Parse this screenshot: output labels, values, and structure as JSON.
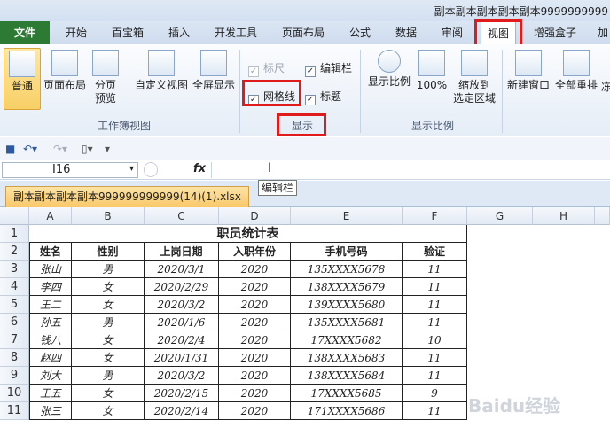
{
  "window": {
    "title": "副本副本副本副本副本9999999999"
  },
  "tabs": [
    "开始",
    "百宝箱",
    "插入",
    "开发工具",
    "页面布局",
    "公式",
    "数据",
    "审阅",
    "视图",
    "增强盒子",
    "加"
  ],
  "file_tab": "文件",
  "ribbon": {
    "workbook_views": {
      "normal": "普通",
      "page_layout": "页面布局",
      "page_break": "分页\n预览",
      "custom_view": "自定义视图",
      "full_screen": "全屏显示",
      "group": "工作簿视图"
    },
    "show": {
      "ruler": "标尺",
      "formula_bar": "编辑栏",
      "gridlines": "网格线",
      "headings": "标题",
      "group": "显示"
    },
    "zoom": {
      "zoom": "显示比例",
      "hundred": "100%",
      "zoom_to_selection": "缩放到\n选定区域",
      "group": "显示比例"
    },
    "window": {
      "new_window": "新建窗口",
      "arrange_all": "全部重排",
      "more": "冻"
    }
  },
  "formula_bar": {
    "name_box": "I16",
    "fx": "fx",
    "value": ""
  },
  "tooltip": "编辑栏",
  "file_tab_name": "副本副本副本副本999999999999(14)(1).xlsx",
  "columns": [
    "A",
    "B",
    "C",
    "D",
    "E",
    "F",
    "G",
    "H"
  ],
  "rows": [
    "1",
    "2",
    "3",
    "4",
    "5",
    "6",
    "7",
    "8",
    "9",
    "10",
    "11"
  ],
  "table": {
    "title": "职员统计表",
    "headers": [
      "姓名",
      "性别",
      "上岗日期",
      "入职年份",
      "手机号码",
      "验证"
    ],
    "data": [
      [
        "张山",
        "男",
        "2020/3/1",
        "2020",
        "135XXXX5678",
        "11"
      ],
      [
        "李四",
        "女",
        "2020/2/29",
        "2020",
        "138XXXX5679",
        "11"
      ],
      [
        "王二",
        "女",
        "2020/3/2",
        "2020",
        "139XXXX5680",
        "11"
      ],
      [
        "孙五",
        "男",
        "2020/1/6",
        "2020",
        "135XXXX5681",
        "11"
      ],
      [
        "钱八",
        "女",
        "2020/2/4",
        "2020",
        "17XXXX5682",
        "10"
      ],
      [
        "赵四",
        "女",
        "2020/1/31",
        "2020",
        "138XXXX5683",
        "11"
      ],
      [
        "刘大",
        "男",
        "2020/3/2",
        "2020",
        "138XXXX5684",
        "11"
      ],
      [
        "王五",
        "女",
        "2020/2/15",
        "2020",
        "17XXXX5685",
        "9"
      ],
      [
        "张三",
        "女",
        "2020/2/14",
        "2020",
        "171XXXX5686",
        "11"
      ]
    ]
  },
  "watermark": "Baidu经验"
}
